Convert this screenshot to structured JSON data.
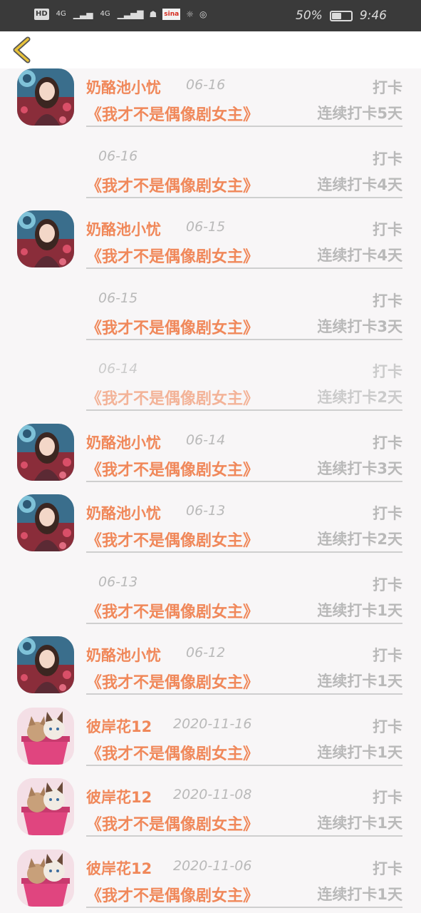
{
  "status_bar": {
    "hd": "HD",
    "net1": "4G",
    "net2": "4G",
    "sina": "sina",
    "battery_pct": "50%",
    "battery_level": 0.5,
    "time": "9:46"
  },
  "nav": {
    "back_icon": "chevron-left-icon",
    "accent": "#e8c23a"
  },
  "colors": {
    "orange": "#f0885a",
    "gray": "#b9b9b9"
  },
  "rows": [
    {
      "avatar": "girl",
      "name": "奶酪池小忧",
      "date": "06-16",
      "action": "打卡",
      "title": "《我才不是偶像剧女主》",
      "streak": "连续打卡5天"
    },
    {
      "avatar": "",
      "name": "",
      "date": "06-16",
      "action": "打卡",
      "title": "《我才不是偶像剧女主》",
      "streak": "连续打卡4天"
    },
    {
      "avatar": "girl",
      "name": "奶酪池小忧",
      "date": "06-15",
      "action": "打卡",
      "title": "《我才不是偶像剧女主》",
      "streak": "连续打卡4天"
    },
    {
      "avatar": "",
      "name": "",
      "date": "06-15",
      "action": "打卡",
      "title": "《我才不是偶像剧女主》",
      "streak": "连续打卡3天"
    },
    {
      "avatar": "",
      "name": "",
      "date": "06-14",
      "action": "打卡",
      "title": "《我才不是偶像剧女主》",
      "streak": "连续打卡2天",
      "faded": true
    },
    {
      "avatar": "girl",
      "name": "奶酪池小忧",
      "date": "06-14",
      "action": "打卡",
      "title": "《我才不是偶像剧女主》",
      "streak": "连续打卡3天"
    },
    {
      "avatar": "girl",
      "name": "奶酪池小忧",
      "date": "06-13",
      "action": "打卡",
      "title": "《我才不是偶像剧女主》",
      "streak": "连续打卡2天"
    },
    {
      "avatar": "",
      "name": "",
      "date": "06-13",
      "action": "打卡",
      "title": "《我才不是偶像剧女主》",
      "streak": "连续打卡1天"
    },
    {
      "avatar": "girl",
      "name": "奶酪池小忧",
      "date": "06-12",
      "action": "打卡",
      "title": "《我才不是偶像剧女主》",
      "streak": "连续打卡1天"
    },
    {
      "avatar": "cats",
      "name": "彼岸花12",
      "date": "2020-11-16",
      "action": "打卡",
      "title": "《我才不是偶像剧女主》",
      "streak": "连续打卡1天"
    },
    {
      "avatar": "cats",
      "name": "彼岸花12",
      "date": "2020-11-08",
      "action": "打卡",
      "title": "《我才不是偶像剧女主》",
      "streak": "连续打卡1天"
    },
    {
      "avatar": "cats",
      "name": "彼岸花12",
      "date": "2020-11-06",
      "action": "打卡",
      "title": "《我才不是偶像剧女主》",
      "streak": "连续打卡1天"
    }
  ]
}
